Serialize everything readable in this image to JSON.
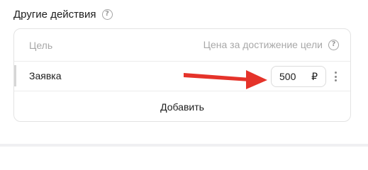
{
  "section": {
    "title": "Другие действия",
    "help_icon": "question-circle-icon"
  },
  "table": {
    "headers": {
      "goal": "Цель",
      "price": "Цена за достижение цели"
    },
    "rows": [
      {
        "goal": "Заявка",
        "price": "500",
        "currency": "₽"
      }
    ],
    "add_label": "Добавить"
  },
  "annotation": {
    "arrow_color": "#e5332a"
  }
}
